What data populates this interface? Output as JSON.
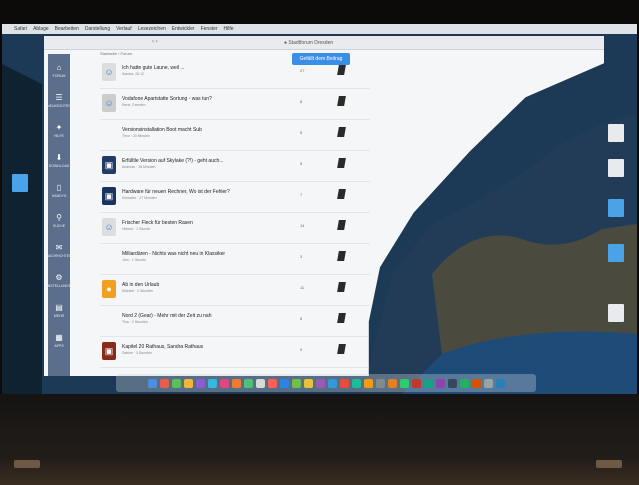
{
  "menubar": {
    "apple": "",
    "items": [
      "Safari",
      "Ablage",
      "Bearbeiten",
      "Darstellung",
      "Verlauf",
      "Lesezeichen",
      "Entwickler",
      "Fenster",
      "Hilfe"
    ]
  },
  "toolbar": {
    "title": "● Stadtforum Dresden",
    "nav": "‹ ›"
  },
  "sidebar": {
    "items": [
      {
        "label": "FORUM",
        "icon": "home-icon"
      },
      {
        "label": "NEUIGKEITEN",
        "icon": "news-icon"
      },
      {
        "label": "HILFE",
        "icon": "bulb-icon"
      },
      {
        "label": "DOWNLOAD",
        "icon": "download-icon"
      },
      {
        "label": "HANDYS",
        "icon": "phone-icon"
      },
      {
        "label": "SUCHE",
        "icon": "search-icon"
      },
      {
        "label": "NACHRICHTEN",
        "icon": "mail-icon"
      },
      {
        "label": "EINSTELLUNGEN",
        "icon": "gear-icon"
      },
      {
        "label": "MEHR",
        "icon": "more-icon"
      },
      {
        "label": "APPS",
        "icon": "apps-icon"
      }
    ]
  },
  "main": {
    "breadcrumb": "Startseite › Forum",
    "primary_button": "Gefällt dem Beitrag",
    "yellow_button": "Zustimmen",
    "threads": [
      {
        "title": "Ich hatte gute Laune, weil ...",
        "meta": "Sandra, 26.12.",
        "stat": "27"
      },
      {
        "title": "Vodafone Apartstatte Sortung - was tun?",
        "meta": "Rene, Dresden",
        "stat": "8"
      },
      {
        "title": "Versionsinstallation Boot macht Sub",
        "meta": "Timo · 20 Minuten",
        "stat": "5"
      },
      {
        "title": "Erfülltle Version auf Skylake (?!) - geht auch...",
        "meta": "Andreas · 18 Minuten",
        "stat": "5"
      },
      {
        "title": "Hardware für neuen Rechner, Wo ist der Fehler?",
        "meta": "Schrader · 27 Minuten",
        "stat": "7"
      },
      {
        "title": "Frischer Fleck für besten Rasen",
        "meta": "Helmut · 1 Stunde",
        "stat": "14"
      },
      {
        "title": "Milliardären - Nichts was nicht neu in Klassiker",
        "meta": "Jörn · 1 Stunde",
        "stat": "3"
      },
      {
        "title": "Ab in den Urlaub",
        "meta": "Michael · 2 Stunden",
        "stat": "11"
      },
      {
        "title": "Nord 2 (Gear) - Mehr mit der Zeit zu nah",
        "meta": "Tina · 2 Stunden",
        "stat": "6"
      },
      {
        "title": "Kapitel 20 Rathaus, Sandra Rathaus",
        "meta": "Sabine · 3 Stunden",
        "stat": "9"
      }
    ]
  },
  "dock": {
    "colors": [
      "#4a8fe0",
      "#e95b4c",
      "#5ac05a",
      "#f2b43a",
      "#8a5cd6",
      "#38b8e0",
      "#e0487f",
      "#f07a30",
      "#4fc07c",
      "#d8d8d8",
      "#ff5f57",
      "#2e83e6",
      "#6fbf4a",
      "#e6c13a",
      "#9b59b6",
      "#3498db",
      "#e74c3c",
      "#1abc9c",
      "#f39c12",
      "#7f8c8d",
      "#e67e22",
      "#2ecc71",
      "#c0392b",
      "#16a085",
      "#8e44ad",
      "#34495e",
      "#27ae60",
      "#d35400",
      "#95a5a6",
      "#2980b9"
    ]
  }
}
